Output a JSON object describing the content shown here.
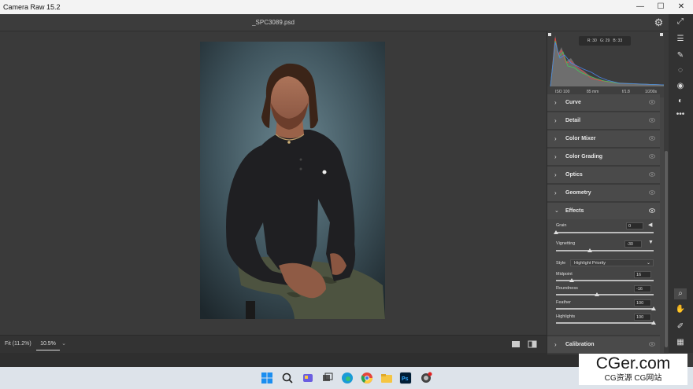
{
  "app": {
    "title": "Camera Raw 15.2",
    "file_name": "_SPC3089.psd"
  },
  "window_controls": {
    "minimize": "—",
    "maximize": "☐",
    "close": "✕"
  },
  "histogram": {
    "r_label": "R:",
    "r_value": "30",
    "g_label": "G:",
    "g_value": "29",
    "b_label": "B:",
    "b_value": "33"
  },
  "exif": {
    "iso": "ISO 100",
    "focal": "85 mm",
    "aperture": "f/1.8",
    "shutter": "1/200s"
  },
  "sections": {
    "curve": "Curve",
    "detail": "Detail",
    "color_mixer": "Color Mixer",
    "color_grading": "Color Grading",
    "optics": "Optics",
    "geometry": "Geometry",
    "effects": "Effects",
    "calibration": "Calibration"
  },
  "effects": {
    "grain": {
      "label": "Grain",
      "value": "0",
      "level": 0
    },
    "vignetting": {
      "label": "Vignetting",
      "value": "-30",
      "level": 0.35
    },
    "style": {
      "label": "Style",
      "value": "Highlight Priority"
    },
    "midpoint": {
      "label": "Midpoint",
      "value": "16",
      "level": 0.16
    },
    "roundness": {
      "label": "Roundness",
      "value": "-16",
      "level": 0.42
    },
    "feather": {
      "label": "Feather",
      "value": "100",
      "level": 1.0
    },
    "highlights": {
      "label": "Highlights",
      "value": "100",
      "level": 1.0
    }
  },
  "bottom": {
    "zoom_fit": "Fit (11.2%)",
    "zoom_value": "10.5%"
  },
  "icons": {
    "gear": "gear-icon",
    "eye": "eye-icon",
    "chevron_right": "chevron-right-icon",
    "chevron_down": "chevron-down-icon",
    "expand": "expand-icon",
    "edit": "sliders-icon",
    "heal": "bandage-icon",
    "mask": "mask-icon",
    "redeye": "red-eye-icon",
    "presets": "presets-icon",
    "more": "more-icon",
    "zoom": "zoom-icon",
    "hand": "hand-icon",
    "sampler": "color-sampler-icon",
    "grid": "grid-icon"
  },
  "watermark": {
    "line1": "CGer.com",
    "line2": "CG资源 CG网站"
  },
  "colors": {
    "panel": "#454545",
    "canvas": "#3a3a3a",
    "accent": "#dddddd"
  }
}
